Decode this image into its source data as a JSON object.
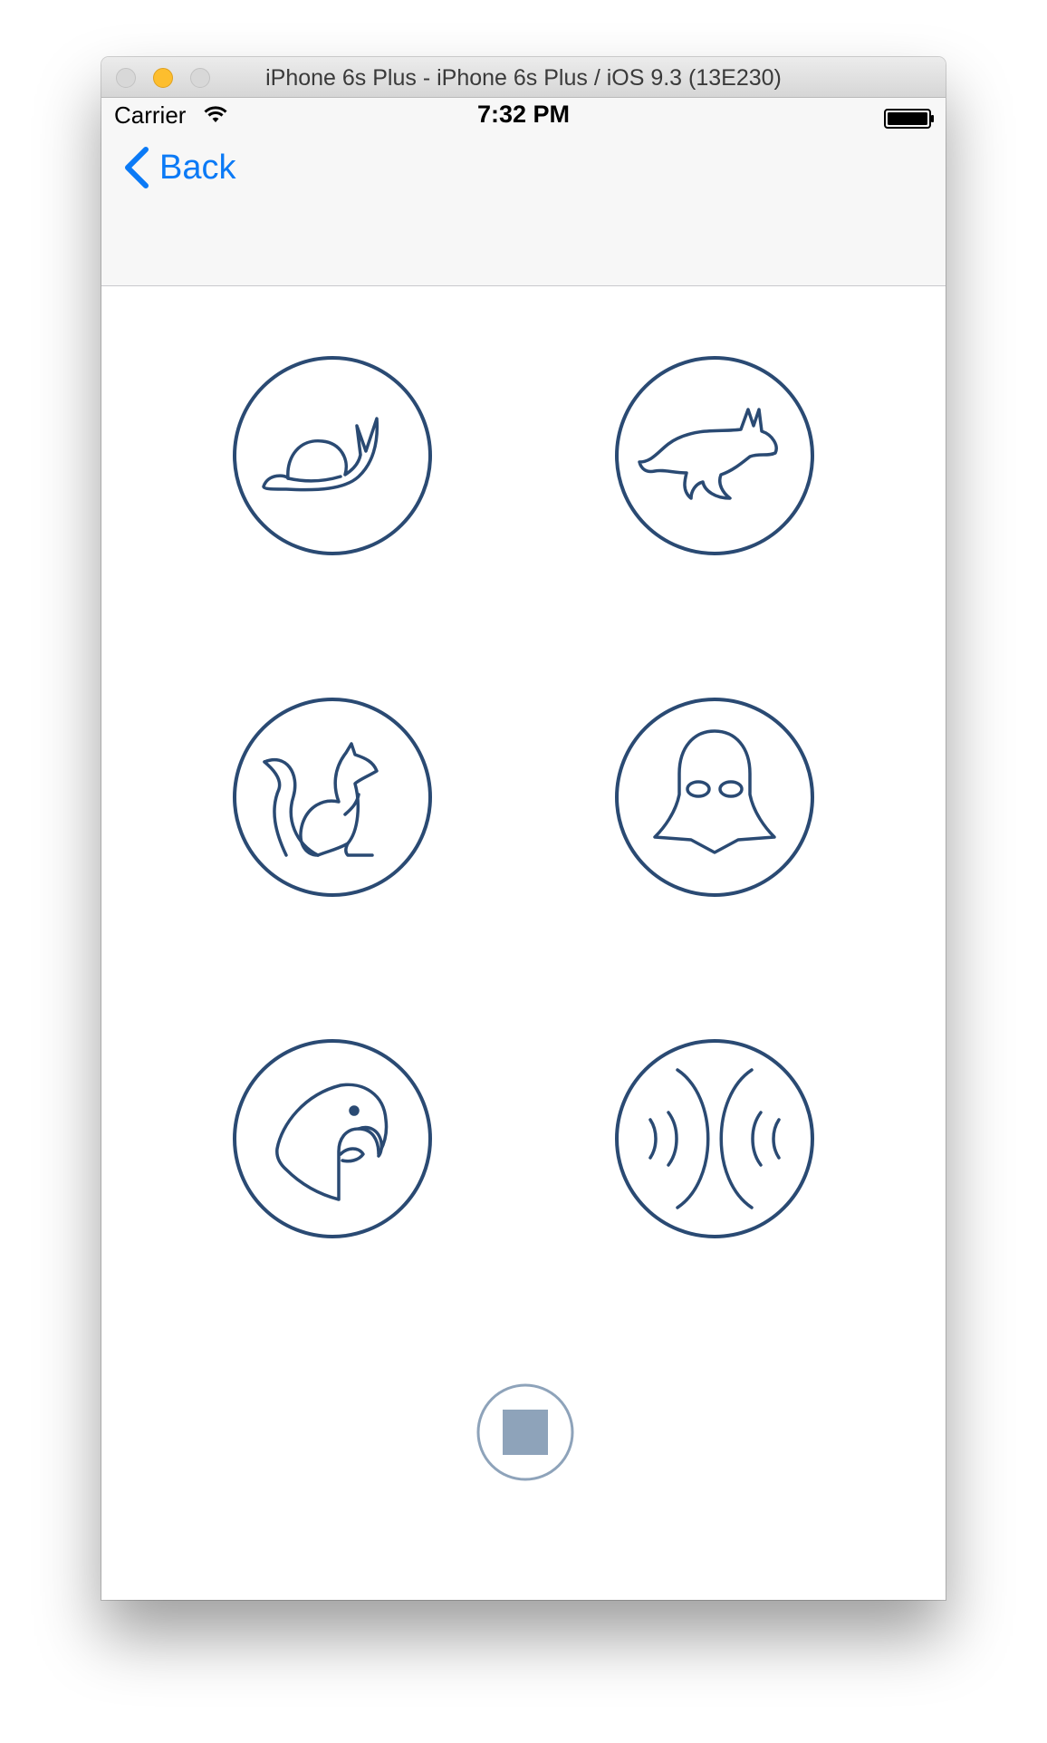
{
  "window": {
    "title": "iPhone 6s Plus - iPhone 6s Plus / iOS 9.3 (13E230)"
  },
  "status_bar": {
    "carrier": "Carrier",
    "time": "7:32 PM",
    "wifi_icon": "wifi-icon",
    "battery_icon": "battery-icon"
  },
  "nav": {
    "back_label": "Back",
    "back_icon": "chevron-left-icon"
  },
  "effects": [
    {
      "icon": "snail-icon"
    },
    {
      "icon": "rabbit-icon"
    },
    {
      "icon": "squirrel-icon"
    },
    {
      "icon": "darth-vader-icon"
    },
    {
      "icon": "parrot-icon"
    },
    {
      "icon": "echo-icon"
    }
  ],
  "stop": {
    "icon": "stop-icon"
  },
  "colors": {
    "accent": "#0b7af6",
    "icon_stroke": "#2a4a73",
    "stop_fill": "#8ea3ba"
  }
}
